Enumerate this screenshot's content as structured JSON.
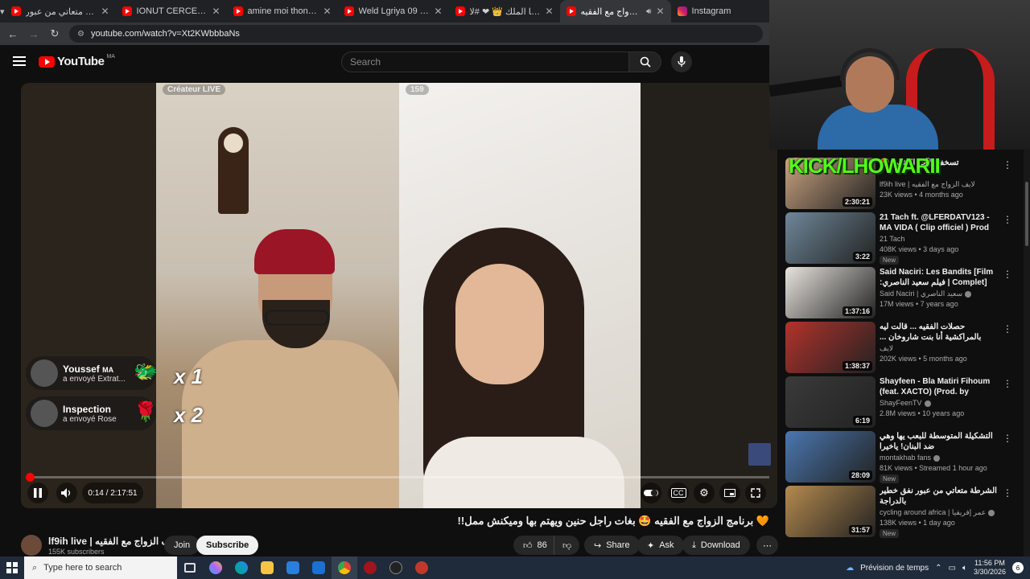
{
  "browser": {
    "tabs": [
      {
        "label": "الشرطة متعاتي من عبور ...",
        "active": false,
        "type": "yt"
      },
      {
        "label": "IONUT CERCEL - MADE IN",
        "active": false,
        "type": "yt"
      },
      {
        "label": "amine moi thon - YouTub",
        "active": false,
        "type": "yt"
      },
      {
        "label": "Weld Lgriya 09 Ft Lz3er, C",
        "active": false,
        "type": "yt"
      },
      {
        "label": "اتصل بيا الملك 👑 ❤ #لا...",
        "active": false,
        "type": "yt"
      },
      {
        "label": "برنامج الزواج مع الفقيه 🤣",
        "active": true,
        "type": "yt"
      },
      {
        "label": "Instagram",
        "active": false,
        "type": "ig"
      }
    ],
    "url": "youtube.com/watch?v=Xt2KWbbbaNs"
  },
  "youtube": {
    "logo_text": "YouTube",
    "country_code": "MA",
    "search_placeholder": "Search"
  },
  "player": {
    "left_pill": "Créateur LIVE",
    "right_pill": "159",
    "gifts": [
      {
        "name": "Youssef",
        "badge": "MA",
        "action": "a envoyé Extrat...",
        "combo": "x 1"
      },
      {
        "name": "Inspection",
        "badge": "",
        "action": "a envoyé Rose",
        "combo": "x 2"
      }
    ],
    "progress_fraction": 0.0016,
    "time_current": "0:14",
    "time_total": "2:17:51",
    "time_display": "0:14 / 2:17:51"
  },
  "video": {
    "title": "🧡 برنامج الزواج مع الفقيه 🤩 بغات راجل حنين ويهتم بها وميكنش ممل!!",
    "channel_name": "lf9ih live | لايف الزواج مع الفقيه",
    "subscribers": "155K subscribers",
    "join_label": "Join",
    "subscribe_label": "Subscribe",
    "likes": "86",
    "share_label": "Share",
    "ask_label": "Ask",
    "download_label": "Download"
  },
  "overlay": {
    "kick_text": "KICK/LHOWARII"
  },
  "recommendations": [
    {
      "title": "تسخف الآخر المثالي 🤩",
      "channel": "lf9ih live | لايف الزواج مع الفقيه",
      "meta": "23K views • 4 months ago",
      "duration": "2:30:21",
      "badge": "",
      "verified": false,
      "color": "#c9a27f"
    },
    {
      "title": "21 Tach ft. @LFERDATV123 - MA VIDA ( Clip officiel ) Prod b...",
      "channel": "21 Tach",
      "meta": "408K views • 3 days ago",
      "duration": "3:22",
      "badge": "New",
      "verified": false,
      "color": "#6e8799"
    },
    {
      "title": "Said Naciri: Les Bandits [Film Complet] | فيلم سعيد الناصري: البانضية",
      "channel": "Said Naciri | سعيد الناصري",
      "meta": "17M views • 7 years ago",
      "duration": "1:37:16",
      "badge": "",
      "verified": true,
      "color": "#e8e4de"
    },
    {
      "title": "حصلات الفقيه ... قالت ليه بالمراكشية أنا بنت شاروخان ... الناس لي عايشين في اوروبا",
      "channel": "لايف",
      "meta": "202K views • 5 months ago",
      "duration": "1:38:37",
      "badge": "",
      "verified": false,
      "color": "#b3322b"
    },
    {
      "title": "Shayfeen - Bla Matiri Fihoum (feat. XACTO) (Prod. by Shobe...",
      "channel": "ShayFeenTV",
      "meta": "2.8M views • 10 years ago",
      "duration": "6:19",
      "badge": "",
      "verified": true,
      "color": "#3a3a3a"
    },
    {
      "title": "التشكيلة المتوسطة للبعب يها وهي ضد البنان! ياخيرا",
      "channel": "montakhab fans",
      "meta": "81K views • Streamed 1 hour ago",
      "duration": "28:09",
      "badge": "New",
      "verified": true,
      "color": "#4a77b0"
    },
    {
      "title": "الشرطة متعاتي من عبور نفق خطير بالدراجة",
      "channel": "cycling around africa | عمر إفريقيا",
      "meta": "138K views • 1 day ago",
      "duration": "31:57",
      "badge": "New",
      "verified": true,
      "color": "#b58a4e"
    }
  ],
  "taskbar": {
    "search_placeholder": "Type here to search",
    "weather": "Prévision de temps",
    "time": "11:56 PM",
    "date": "3/30/2026",
    "notif_count": "6"
  }
}
